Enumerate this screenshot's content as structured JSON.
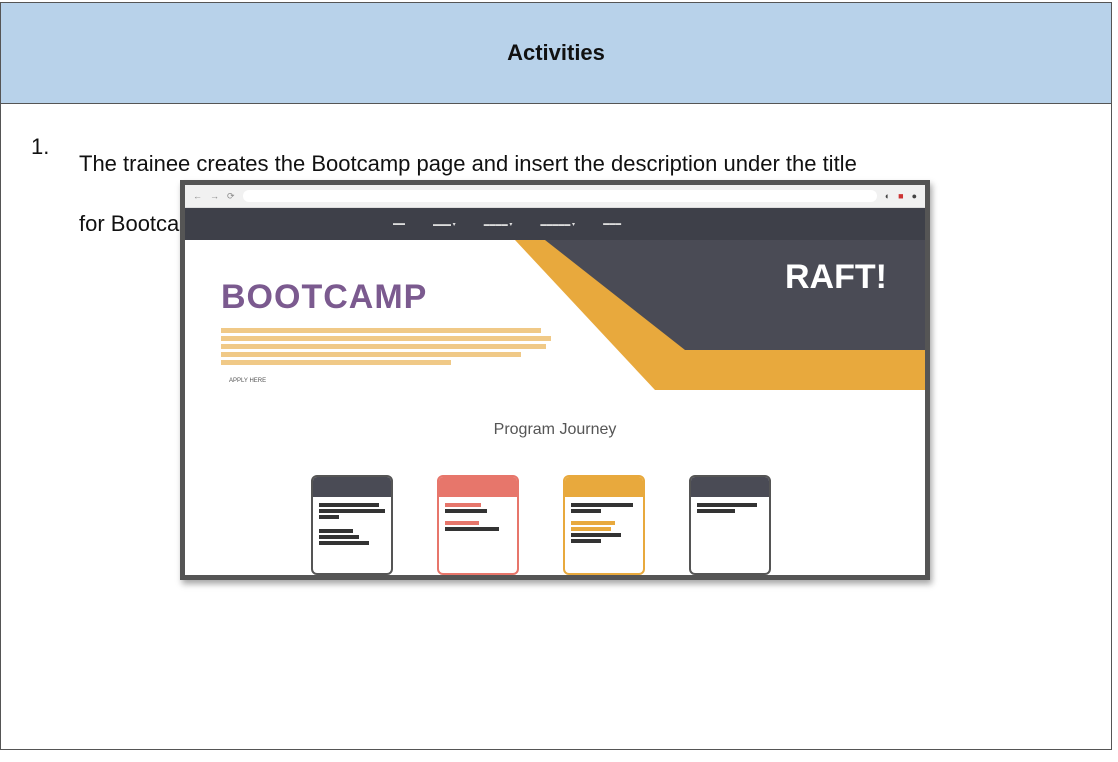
{
  "header": {
    "title": "Activities"
  },
  "item": {
    "number": "1.",
    "line1": "The trainee creates the Bootcamp page and insert the description under the title",
    "line2": "for Bootcamp, Masterclass and Immersion page."
  },
  "screenshot": {
    "hero_title": "BOOTCAMP",
    "apply_label": "APPLY HERE",
    "raft_logo": "RAFT!",
    "journey_title": "Program Journey",
    "colors": {
      "nav": "#3e4049",
      "accent": "#e8a93d",
      "title": "#7b5a8f",
      "day2": "#e7766b"
    }
  }
}
